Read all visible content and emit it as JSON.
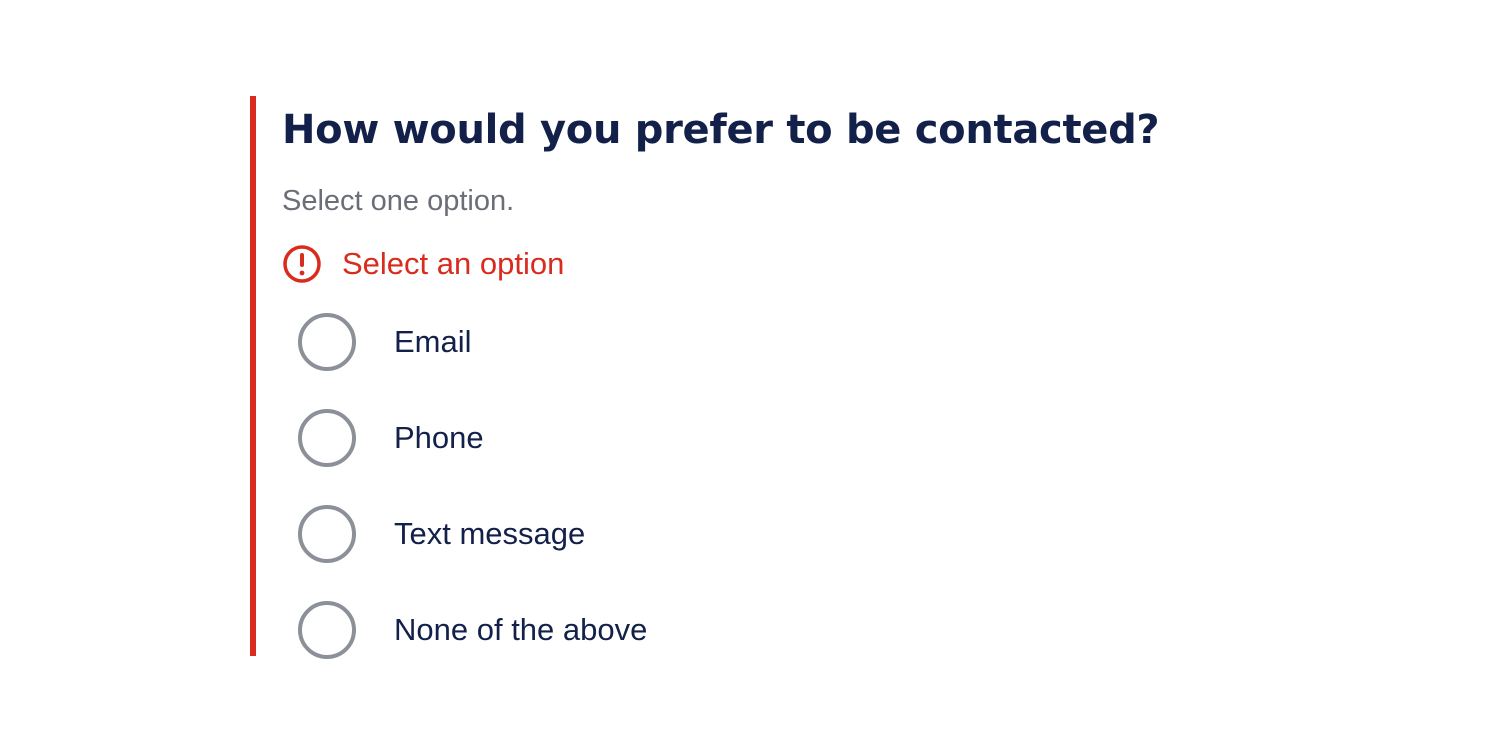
{
  "question": {
    "title": "How would you prefer to be contacted?",
    "hint": "Select one option."
  },
  "error": {
    "message": "Select an option",
    "icon": "alert-circle-icon",
    "color": "#d92b1e"
  },
  "options": [
    {
      "label": "Email",
      "selected": false
    },
    {
      "label": "Phone",
      "selected": false
    },
    {
      "label": "Text message",
      "selected": false
    },
    {
      "label": "None of the above",
      "selected": false
    }
  ],
  "colors": {
    "heading": "#13214a",
    "hint": "#6b6e78",
    "error": "#d92b1e",
    "radio_border": "#8b9099"
  }
}
